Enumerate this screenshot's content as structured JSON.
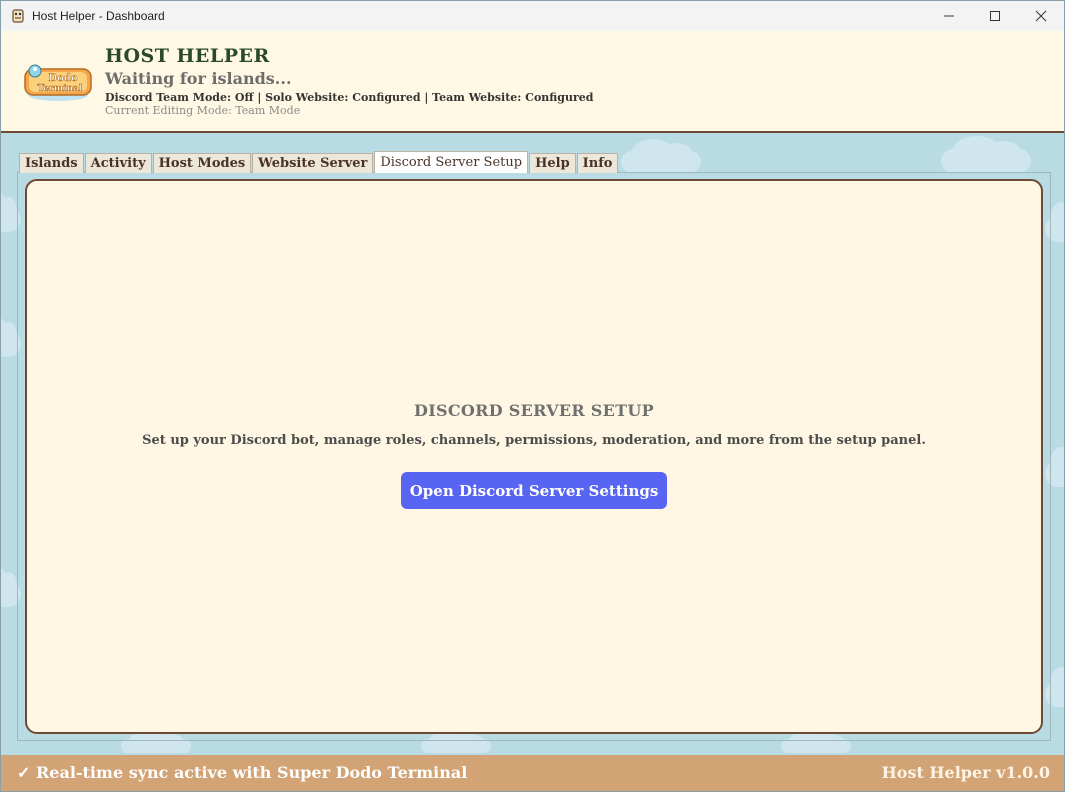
{
  "window": {
    "title": "Host Helper - Dashboard"
  },
  "header": {
    "logo_text_top": "Dodo",
    "logo_text_bottom": "Terminal",
    "title": "HOST HELPER",
    "subtitle": "Waiting for islands...",
    "status_line": "Discord Team Mode: Off | Solo Website: Configured | Team Website: Configured",
    "editing_mode": "Current Editing Mode: Team Mode"
  },
  "tabs": [
    {
      "label": "Islands",
      "active": false
    },
    {
      "label": "Activity",
      "active": false
    },
    {
      "label": "Host Modes",
      "active": false
    },
    {
      "label": "Website Server",
      "active": false
    },
    {
      "label": "Discord Server Setup",
      "active": true
    },
    {
      "label": "Help",
      "active": false
    },
    {
      "label": "Info",
      "active": false
    }
  ],
  "panel": {
    "heading": "DISCORD SERVER SETUP",
    "description": "Set up your Discord bot, manage roles, channels, permissions, moderation, and more from the setup panel.",
    "button_label": "Open Discord Server Settings"
  },
  "footer": {
    "sync_status": "✓ Real-time sync active with Super Dodo Terminal",
    "version": "Host Helper v1.0.0"
  },
  "colors": {
    "background": "#b9dbe4",
    "header_bg": "#fff8e4",
    "panel_bg": "#fff7e4",
    "panel_border": "#6e4a36",
    "button": "#5865f2",
    "footer_bg": "#d2a374",
    "title_green": "#294a24"
  }
}
